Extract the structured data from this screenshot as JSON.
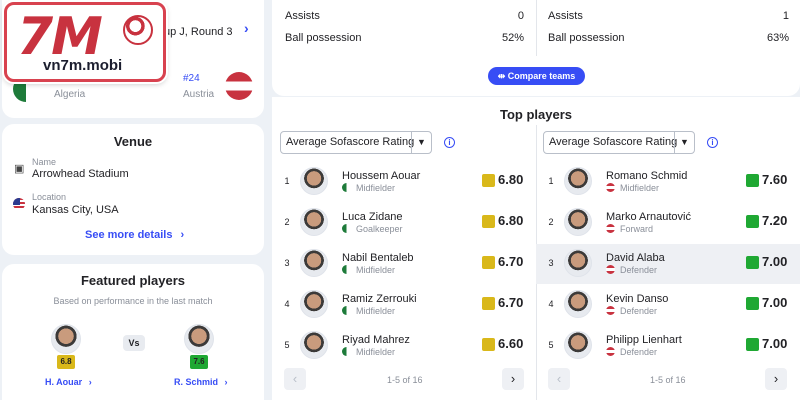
{
  "logo": {
    "mark": "7M",
    "domain": "vn7m.mobi"
  },
  "match": {
    "title": "Group J, Round 3",
    "title_visible": "up J, Round 3",
    "home_team": "Algeria",
    "away_team": "Austria",
    "away_rank": "#24"
  },
  "venue": {
    "heading": "Venue",
    "name_label": "Name",
    "name_value": "Arrowhead Stadium",
    "location_label": "Location",
    "location_value": "Kansas City, USA",
    "more_link": "See more details"
  },
  "featured": {
    "heading": "Featured players",
    "subtitle": "Based on performance in the last match",
    "vs": "Vs",
    "left": {
      "name": "H. Aouar",
      "rating": "6.8"
    },
    "right": {
      "name": "R. Schmid",
      "rating": "7.6"
    }
  },
  "stats": {
    "left": [
      {
        "label": "Assists",
        "value": "0"
      },
      {
        "label": "Ball possession",
        "value": "52%"
      }
    ],
    "right": [
      {
        "label": "Assists",
        "value": "1"
      },
      {
        "label": "Ball possession",
        "value": "63%"
      }
    ],
    "compare_button": "Compare teams"
  },
  "top_players": {
    "heading": "Top players",
    "select_label": "Average Sofascore Rating",
    "pager_text": "1-5 of 16",
    "left": [
      {
        "rank": "1",
        "name": "Houssem Aouar",
        "position": "Midfielder",
        "rating": "6.80"
      },
      {
        "rank": "2",
        "name": "Luca Zidane",
        "position": "Goalkeeper",
        "rating": "6.80"
      },
      {
        "rank": "3",
        "name": "Nabil Bentaleb",
        "position": "Midfielder",
        "rating": "6.70"
      },
      {
        "rank": "4",
        "name": "Ramiz Zerrouki",
        "position": "Midfielder",
        "rating": "6.70"
      },
      {
        "rank": "5",
        "name": "Riyad Mahrez",
        "position": "Midfielder",
        "rating": "6.60"
      }
    ],
    "right": [
      {
        "rank": "1",
        "name": "Romano Schmid",
        "position": "Midfielder",
        "rating": "7.60"
      },
      {
        "rank": "2",
        "name": "Marko Arnautović",
        "position": "Forward",
        "rating": "7.20"
      },
      {
        "rank": "3",
        "name": "David Alaba",
        "position": "Defender",
        "rating": "7.00"
      },
      {
        "rank": "4",
        "name": "Kevin Danso",
        "position": "Defender",
        "rating": "7.00"
      },
      {
        "rank": "5",
        "name": "Philipp Lienhart",
        "position": "Defender",
        "rating": "7.00"
      }
    ]
  },
  "colors": {
    "accent": "#374df5",
    "rating_yellow": "#d9b81a",
    "rating_green": "#1fa833",
    "background": "#edf1f6"
  }
}
